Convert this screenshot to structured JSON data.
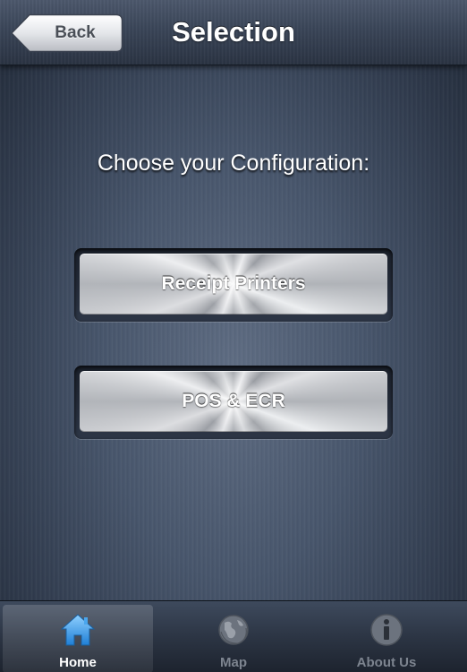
{
  "navbar": {
    "back_label": "Back",
    "title": "Selection"
  },
  "content": {
    "prompt": "Choose your Configuration:",
    "buttons": [
      {
        "label": "Receipt Printers"
      },
      {
        "label": "POS & ECR"
      }
    ]
  },
  "tabbar": {
    "selected": "Home",
    "tabs": [
      {
        "label": "Home",
        "icon": "home-icon"
      },
      {
        "label": "Map",
        "icon": "globe-icon"
      },
      {
        "label": "About Us",
        "icon": "info-icon"
      }
    ]
  },
  "colors": {
    "active_tab_icon": "#3fa3ee",
    "inactive_tab": "#7d848f"
  }
}
